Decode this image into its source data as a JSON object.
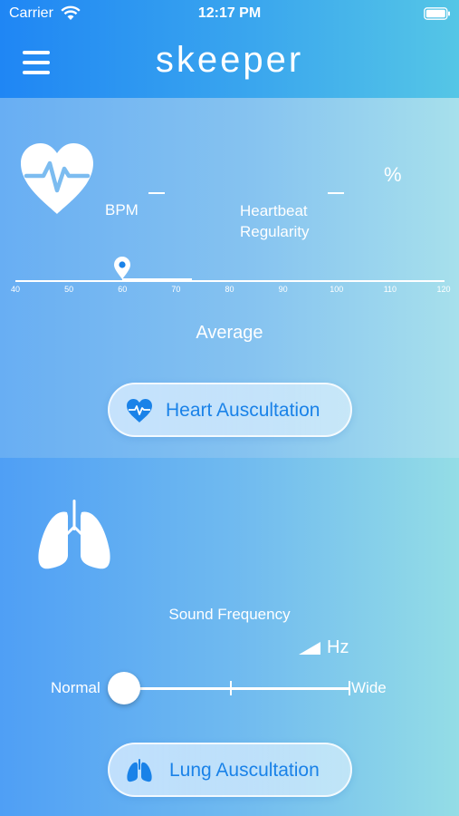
{
  "status_bar": {
    "carrier": "Carrier",
    "time": "12:17 PM"
  },
  "header": {
    "logo": "skeeper"
  },
  "heart": {
    "bpm_value": "—",
    "bpm_label": "BPM",
    "regularity_value": "—",
    "regularity_label": "Heartbeat Regularity",
    "percent": "%",
    "scale_ticks": [
      "40",
      "50",
      "60",
      "70",
      "80",
      "90",
      "100",
      "110",
      "120"
    ],
    "marker_value": 60,
    "average_label": "Average",
    "button_label": "Heart Auscultation"
  },
  "lung": {
    "frequency_label": "Sound Frequency",
    "unit": "Hz",
    "min_label": "Normal",
    "max_label": "Wide",
    "slider_value": 0,
    "button_label": "Lung Auscultation"
  },
  "colors": {
    "accent": "#1a82e8",
    "header_start": "#1f86f4",
    "header_end": "#55c6e6"
  }
}
